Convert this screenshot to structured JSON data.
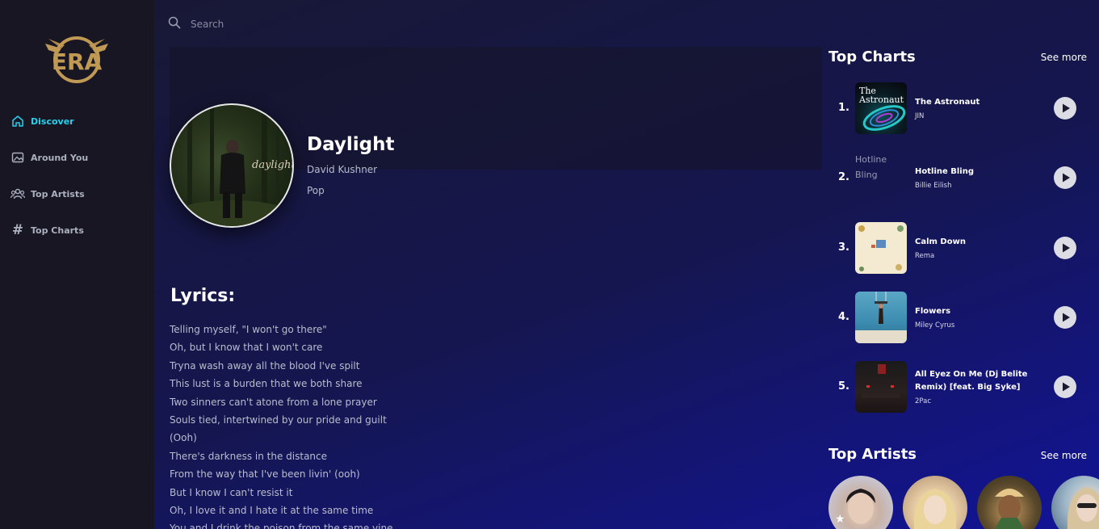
{
  "sidebar": {
    "logo_alt": "ERA",
    "items": [
      {
        "label": "Discover",
        "icon": "home-icon",
        "active": true
      },
      {
        "label": "Around You",
        "icon": "image-icon"
      },
      {
        "label": "Top Artists",
        "icon": "users-icon"
      },
      {
        "label": "Top Charts",
        "icon": "hash-icon"
      }
    ]
  },
  "search": {
    "placeholder": "Search",
    "value": ""
  },
  "song": {
    "title": "Daylight",
    "artist": "David Kushner",
    "genre": "Pop",
    "cover_text": "daylight"
  },
  "lyrics": {
    "heading": "Lyrics:",
    "lines": [
      "Telling myself, \"I won't go there\"",
      "Oh, but I know that I won't care",
      "Tryna wash away all the blood I've spilt",
      "This lust is a burden that we both share",
      "Two sinners can't atone from a lone prayer",
      "Souls tied, intertwined by our pride and guilt",
      "(Ooh)",
      "There's darkness in the distance",
      "From the way that I've been livin' (ooh)",
      "But I know I can't resist it",
      "Oh, I love it and I hate it at the same time",
      "You and I drink the poison from the same vine"
    ]
  },
  "top_charts": {
    "heading": "Top Charts",
    "see_more": "See more",
    "items": [
      {
        "rank": "1.",
        "title": "The Astronaut",
        "artist": "JIN",
        "thumb_text": "The Astronaut"
      },
      {
        "rank": "2.",
        "title": "Hotline Bling",
        "artist": "Billie Eilish",
        "thumb_alt": "Hotline Bling"
      },
      {
        "rank": "3.",
        "title": "Calm Down",
        "artist": "Rema"
      },
      {
        "rank": "4.",
        "title": "Flowers",
        "artist": "Miley Cyrus"
      },
      {
        "rank": "5.",
        "title": "All Eyez On Me (Dj Belite Remix) [feat. Big Syke]",
        "artist": "2Pac"
      }
    ]
  },
  "top_artists": {
    "heading": "Top Artists",
    "see_more": "See more"
  },
  "colors": {
    "accent": "#22d3ee",
    "logo_gold": "#c09a55",
    "sidebar_bg": "#191624"
  }
}
